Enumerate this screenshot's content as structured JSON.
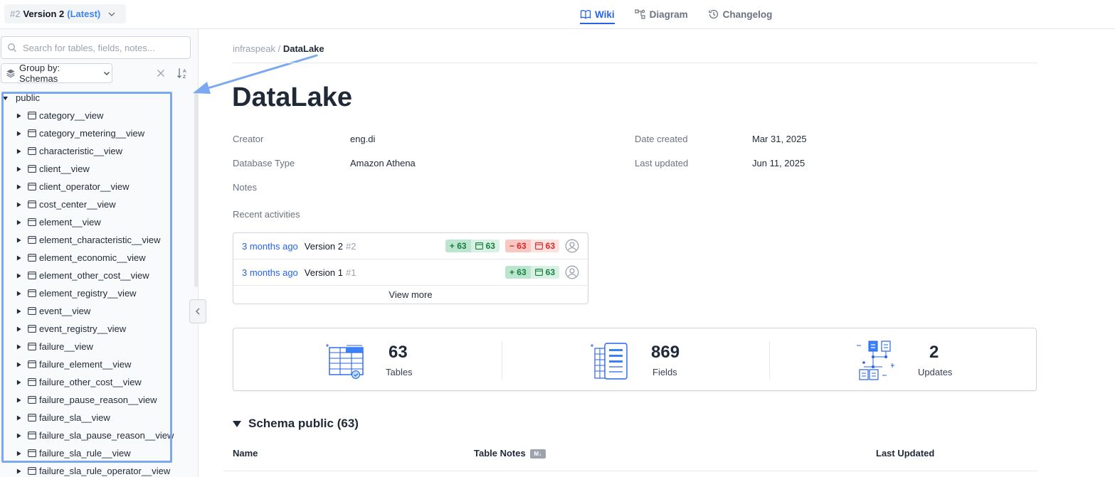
{
  "topbar": {
    "version_num": "#2",
    "version_name": "Version 2",
    "version_tag": "(Latest)",
    "tabs": [
      {
        "label": "Wiki",
        "icon": "book-icon",
        "active": true
      },
      {
        "label": "Diagram",
        "icon": "diagram-icon",
        "active": false
      },
      {
        "label": "Changelog",
        "icon": "history-icon",
        "active": false
      }
    ]
  },
  "sidebar": {
    "search_placeholder": "Search for tables, fields, notes...",
    "group_by_label": "Group by: Schemas",
    "schema_name": "public",
    "tables": [
      "category__view",
      "category_metering__view",
      "characteristic__view",
      "client__view",
      "client_operator__view",
      "cost_center__view",
      "element__view",
      "element_characteristic__view",
      "element_economic__view",
      "element_other_cost__view",
      "element_registry__view",
      "event__view",
      "event_registry__view",
      "failure__view",
      "failure_element__view",
      "failure_other_cost__view",
      "failure_pause_reason__view",
      "failure_sla__view",
      "failure_sla_pause_reason__view",
      "failure_sla_rule__view",
      "failure_sla_rule_operator__view"
    ]
  },
  "main": {
    "breadcrumb_parent": "infraspeak",
    "breadcrumb_sep": " / ",
    "breadcrumb_current": "DataLake",
    "title": "DataLake",
    "meta": {
      "creator_label": "Creator",
      "creator_value": "eng.di",
      "dbtype_label": "Database Type",
      "dbtype_value": "Amazon Athena",
      "notes_label": "Notes",
      "date_created_label": "Date created",
      "date_created_value": "Mar 31, 2025",
      "last_updated_label": "Last updated",
      "last_updated_value": "Jun 11, 2025"
    },
    "recent_label": "Recent activities",
    "activities": [
      {
        "when": "3 months ago",
        "version": "Version 2",
        "hash": "#2",
        "added": "+ 63",
        "added_tables": "63",
        "removed": "− 63",
        "removed_tables": "63"
      },
      {
        "when": "3 months ago",
        "version": "Version 1",
        "hash": "#1",
        "added": "+ 63",
        "added_tables": "63"
      }
    ],
    "view_more": "View more",
    "stats": [
      {
        "value": "63",
        "label": "Tables"
      },
      {
        "value": "869",
        "label": "Fields"
      },
      {
        "value": "2",
        "label": "Updates"
      }
    ],
    "schema_heading": "Schema public (63)",
    "columns": {
      "name": "Name",
      "notes": "Table Notes",
      "md_badge": "M↓",
      "updated": "Last Updated"
    }
  },
  "colors": {
    "accent": "#2563eb",
    "highlight": "#7aa9f0",
    "add_green": "#15803d",
    "remove_red": "#dc2626"
  }
}
